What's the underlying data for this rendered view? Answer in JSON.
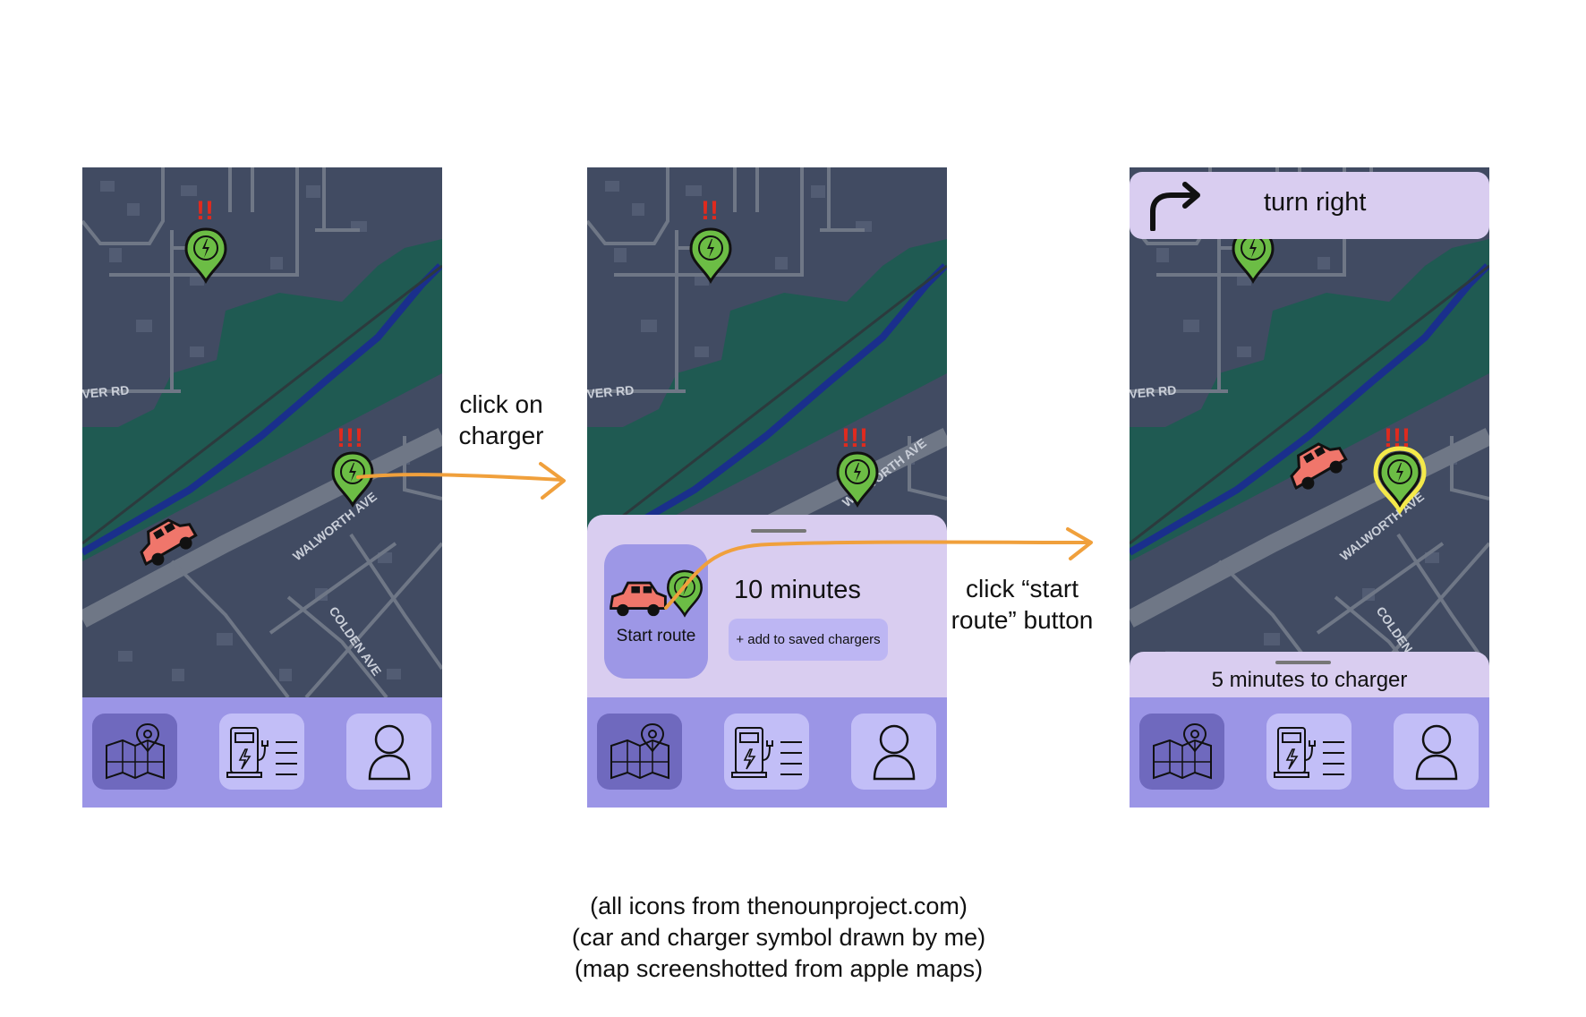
{
  "colors": {
    "map_water": "#1f5a52",
    "map_land": "#414b62",
    "map_road": "#6f7786",
    "map_river": "#1a2f8c",
    "nav_bar": "#9b95e6",
    "nav_button": "#c2bef7",
    "nav_button_active": "#6f69be",
    "sheet": "#d9cdf0",
    "arrow": "#f0a03c",
    "pin": "#6cbd45",
    "car": "#f0766b",
    "alert": "#e02a1e",
    "highlight": "#f4e94a"
  },
  "map_labels": {
    "road_1": "VER RD",
    "road_2": "WALWORTH AVE",
    "road_3": "COLDEN AVE",
    "alert_2": "!!",
    "alert_3": "!!!"
  },
  "annotations": {
    "step1": [
      "click on",
      "charger"
    ],
    "step2": [
      "click “start",
      "route” button"
    ]
  },
  "screen2": {
    "start_route_label": "Start route",
    "minutes": "10 minutes",
    "save_button": "+ add to saved chargers"
  },
  "screen3": {
    "instruction": "turn right",
    "status": "5 minutes to charger"
  },
  "nav": {
    "icons": [
      "map-icon",
      "charger-list-icon",
      "profile-icon"
    ]
  },
  "footer": [
    "(all icons from thenounproject.com)",
    "(car and charger symbol drawn by me)",
    "(map screenshotted from apple maps)"
  ]
}
